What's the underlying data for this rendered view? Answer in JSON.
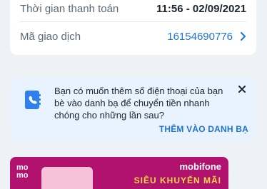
{
  "transaction": {
    "time_label": "Thời gian thanh toán",
    "time_value": "11:56 - 02/09/2021",
    "id_label": "Mã giao dịch",
    "id_value": "16154690776"
  },
  "notice": {
    "message": "Bạn có muốn thêm số điện thoại của bạn bè vào danh bạ để chuyển tiền nhanh chóng cho những lần sau?",
    "action_label": "THÊM VÀO DANH BẠ",
    "icon": "contact-book-icon"
  },
  "banner": {
    "logo_line1": "mo",
    "logo_line2": "mo",
    "brand": "mobifone",
    "headline": "SIÊU KHUYẾN MÃI",
    "bg_color": "#b0126e"
  },
  "colors": {
    "accent": "#1f73d0",
    "notice_bg": "#e9f3ff",
    "page_bg": "#eef1f5"
  }
}
